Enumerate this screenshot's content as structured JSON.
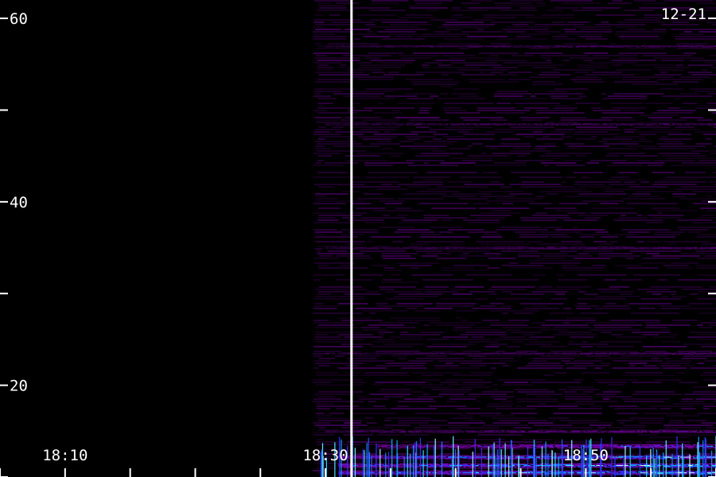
{
  "chart_data": {
    "type": "heatmap",
    "date_label": "12-21",
    "y_ticks": [
      {
        "value": 10,
        "label": ""
      },
      {
        "value": 20,
        "label": "20"
      },
      {
        "value": 30,
        "label": ""
      },
      {
        "value": 40,
        "label": "40"
      },
      {
        "value": 50,
        "label": ""
      },
      {
        "value": 60,
        "label": "60"
      }
    ],
    "ylim": [
      10,
      62
    ],
    "x_ticks": [
      {
        "value": "18:05",
        "label": ""
      },
      {
        "value": "18:10",
        "label": "18:10"
      },
      {
        "value": "18:15",
        "label": ""
      },
      {
        "value": "18:20",
        "label": ""
      },
      {
        "value": "18:25",
        "label": ""
      },
      {
        "value": "18:30",
        "label": "18:30"
      },
      {
        "value": "18:35",
        "label": ""
      },
      {
        "value": "18:40",
        "label": ""
      },
      {
        "value": "18:45",
        "label": ""
      },
      {
        "value": "18:50",
        "label": "18:50"
      },
      {
        "value": "18:55",
        "label": ""
      },
      {
        "value": "19:00",
        "label": ""
      }
    ],
    "xlim": [
      "18:05",
      "19:00"
    ],
    "data_start": "18:29",
    "marker_time": "18:32",
    "colorscale": [
      "#000000",
      "#3a0050",
      "#7a00a8",
      "#2b35ff",
      "#00d8ff",
      "#ffffff"
    ],
    "bands": [
      {
        "y": 10.5,
        "intensity": 1.0,
        "start": "18:31"
      },
      {
        "y": 11.3,
        "intensity": 0.95,
        "start": "18:31"
      },
      {
        "y": 12.2,
        "intensity": 0.9,
        "start": "18:31"
      },
      {
        "y": 13.4,
        "intensity": 0.65,
        "start": "18:34"
      },
      {
        "y": 15.0,
        "intensity": 0.4,
        "start": "18:30"
      },
      {
        "y": 23.5,
        "intensity": 0.3,
        "start": "18:30"
      },
      {
        "y": 35.0,
        "intensity": 0.3,
        "start": "18:30"
      },
      {
        "y": 48.5,
        "intensity": 0.28,
        "start": "18:30"
      },
      {
        "y": 57.0,
        "intensity": 0.28,
        "start": "18:30"
      }
    ],
    "background_intensity": 0.15,
    "grid": false,
    "legend": "none"
  }
}
